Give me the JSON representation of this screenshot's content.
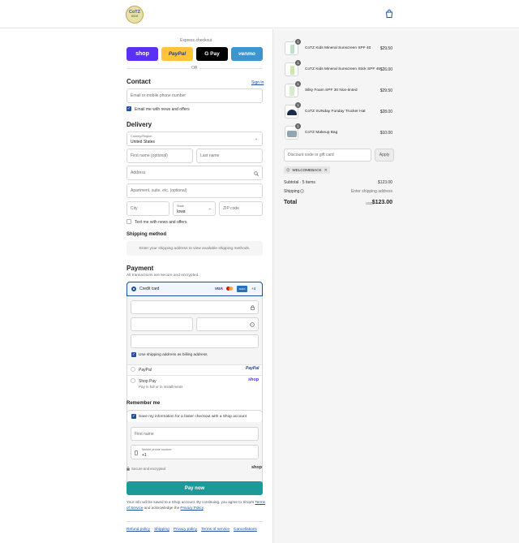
{
  "header": {
    "logo_text_top": "CoTZ",
    "logo_text_bottom": "KIDS",
    "cart_icon": "shopping-bag-icon"
  },
  "express": {
    "title": "Express checkout",
    "buttons": [
      "shop",
      "PayPal",
      "G Pay",
      "venmo"
    ],
    "or": "OR"
  },
  "contact": {
    "heading": "Contact",
    "sign_in": "Sign in",
    "placeholder": "Email or mobile phone number",
    "news_label": "Email me with news and offers"
  },
  "delivery": {
    "heading": "Delivery",
    "country_label": "Country/Region",
    "country_value": "United States",
    "first_name": "First name (optional)",
    "last_name": "Last name",
    "address": "Address",
    "apartment": "Apartment, suite, etc. (optional)",
    "city": "City",
    "state_label": "State",
    "state_value": "Iowa",
    "zip": "ZIP code",
    "text_news": "Text me with news and offers"
  },
  "shipping": {
    "heading": "Shipping method",
    "note": "Enter your shipping address to view available shipping methods."
  },
  "payment": {
    "heading": "Payment",
    "subtitle": "All transactions are secure and encrypted.",
    "credit_card": "Credit card",
    "card_brands": [
      "VISA",
      "MC",
      "AMEX",
      "+4"
    ],
    "billing_label": "Use shipping address as billing address",
    "paypal": "PayPal",
    "paypal_logo": "PayPal",
    "shop_pay": "Shop Pay",
    "shop_pay_sub": "Pay in full or in installments",
    "shop_logo": "shop"
  },
  "remember": {
    "heading": "Remember me",
    "save_label": "Save my information for a faster checkout with a Shop account",
    "first_name": "First name",
    "phone_label": "Mobile phone number",
    "phone_prefix": "+1",
    "secure": "Secure and encrypted",
    "shop_logo": "shop"
  },
  "pay_now": "Pay now",
  "legal": {
    "text1": "Your info will be saved to a Shop account. By continuing, you agree to Shop's",
    "tos": "Terms of Service",
    "text2": "and acknowledge the",
    "privacy": "Privacy Policy",
    "end": "."
  },
  "footer_links": [
    "Refund policy",
    "Shipping",
    "Privacy policy",
    "Terms of service",
    "Cancellations"
  ],
  "cart": {
    "items": [
      {
        "name": "CoTZ Kids Mineral Sunscreen SPF 40",
        "price": "$29.50",
        "qty": "1"
      },
      {
        "name": "CoTZ Kids Mineral Sunscreen Stick SPF 45",
        "price": "$26.00",
        "qty": "1"
      },
      {
        "name": "Silky Foam SPF 30 Non-tinted",
        "price": "$29.50",
        "qty": "1"
      },
      {
        "name": "CoTZ SUNday Funday Trucker Hat",
        "price": "$28.00",
        "qty": "1"
      },
      {
        "name": "CoTZ Makeup Bag",
        "price": "$10.00",
        "qty": "1"
      }
    ],
    "discount_placeholder": "Discount code or gift card",
    "apply": "Apply",
    "code_tag": "WELCOMEBACK",
    "subtotal_label": "Subtotal · 5 items",
    "subtotal_value": "$123.00",
    "shipping_label": "Shipping",
    "shipping_value": "Enter shipping address",
    "total_label": "Total",
    "currency": "USD",
    "total_value": "$123.00"
  }
}
